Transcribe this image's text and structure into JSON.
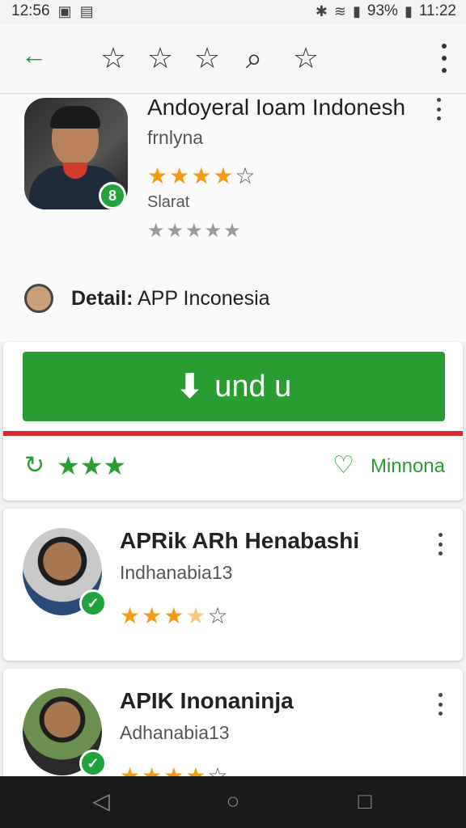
{
  "status_bar": {
    "time_left": "12:56",
    "battery": "93%",
    "time_right": "11:22"
  },
  "toolbar": {
    "icons": [
      "back-arrow",
      "star",
      "star",
      "star",
      "search",
      "star",
      "more"
    ]
  },
  "app": {
    "title": "Andoyeral Ioam Indonesh",
    "subtitle": "frnlyna",
    "rating_label": "Slarat",
    "rating": 4,
    "rating_max": 5
  },
  "detail": {
    "prefix": "Detail:",
    "text": "APP Inconesia"
  },
  "install": {
    "button_label": "und u",
    "footer_label": "Minnona"
  },
  "list": [
    {
      "title": "APRik ARh Henabashi",
      "subtitle": "Indhanabia13",
      "rating": 3.5
    },
    {
      "title": "APIK Inonaninja",
      "subtitle": "Adhanabia13",
      "rating": 4
    }
  ],
  "colors": {
    "accent_green": "#2a9d31",
    "star_orange": "#f39a12",
    "divider_red": "#d62b2b"
  }
}
